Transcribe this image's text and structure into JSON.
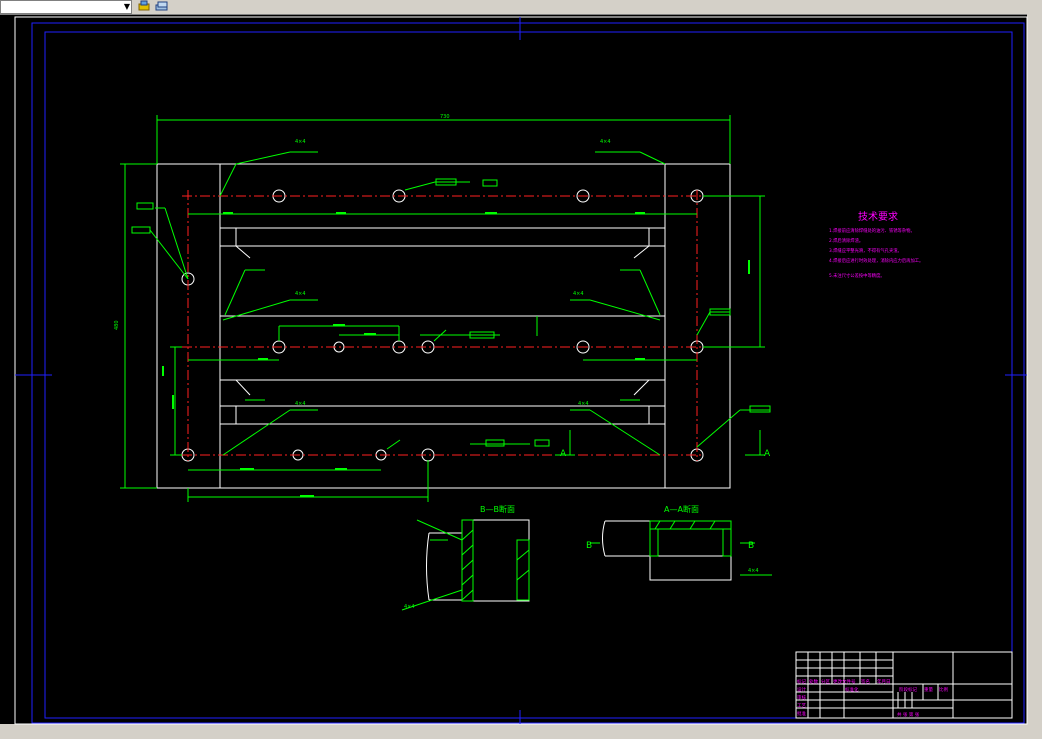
{
  "colors": {
    "background": "#000000",
    "frame": "#2020ff",
    "geometry": "#ffffff",
    "dimension": "#00ff00",
    "centerline": "#ff2020",
    "notes": "#ff00ff",
    "ui_chrome": "#d4d0c8"
  },
  "toolbar": {
    "layer_combo_value": "",
    "icons": [
      "layer-state-icon",
      "layer-properties-icon"
    ]
  },
  "drawing": {
    "overall_dim": "730",
    "left_dim": "480",
    "section_bb_title": "B—B断面",
    "section_aa_title": "A—A断面",
    "section_marker_a": "A",
    "section_marker_b": "B",
    "weld_symbol": "4×4",
    "tech_req_title": "技术要求",
    "tech_req_lines": [
      "1.焊接前应清除焊缝处的油污、铁锈等杂物。",
      "2.焊后清除焊渣。",
      "3.焊缝应平整光滑，不得有气孔夹渣。",
      "4.焊接后应进行时效处理，消除内应力后再加工。",
      "5.未注尺寸公差按中等精度。"
    ]
  },
  "title_block": {
    "row1": [
      "标记",
      "处数",
      "分区",
      "更改文件号",
      "签名",
      "年月日"
    ],
    "row2": [
      "设计",
      "标准化",
      "阶段标记",
      "重量",
      "比例"
    ],
    "row3": [
      "审核",
      "工艺",
      "批准"
    ],
    "sheet": "共 张 第 张"
  }
}
